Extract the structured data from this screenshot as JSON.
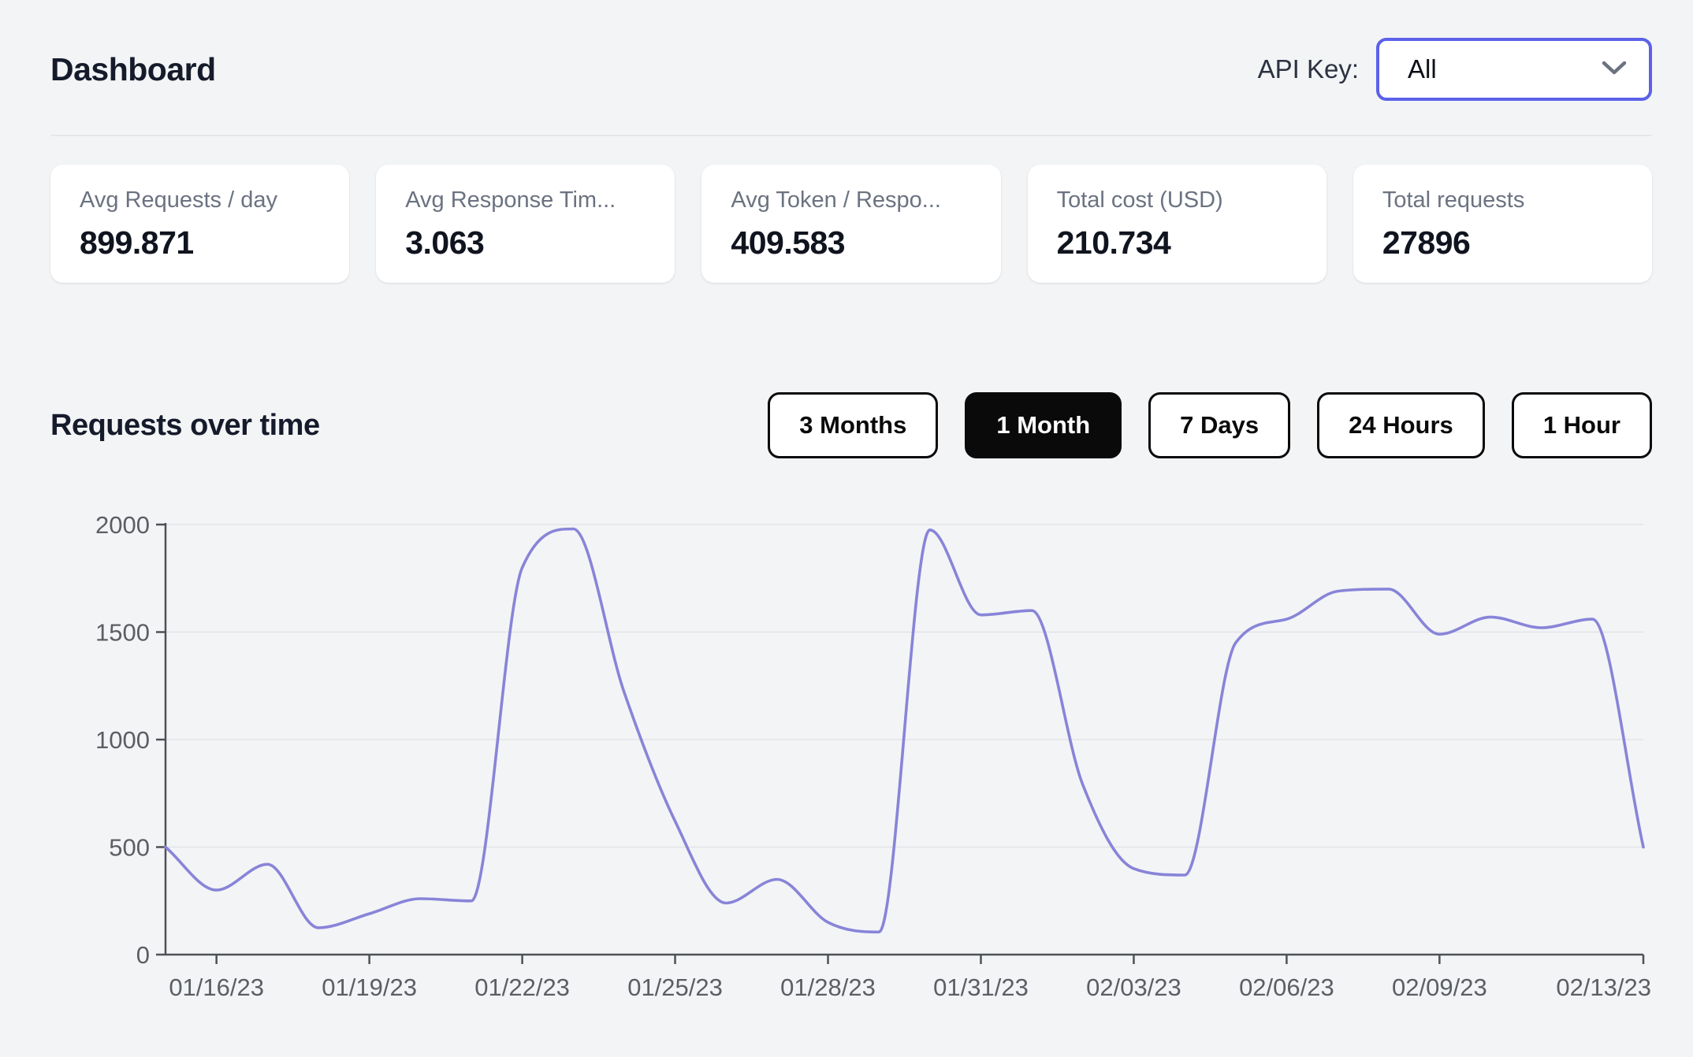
{
  "header": {
    "title": "Dashboard",
    "api_key_label": "API Key:",
    "api_key_value": "All"
  },
  "stats": [
    {
      "label": "Avg Requests / day",
      "value": "899.871"
    },
    {
      "label": "Avg Response Tim...",
      "value": "3.063"
    },
    {
      "label": "Avg Token / Respo...",
      "value": "409.583"
    },
    {
      "label": "Total cost (USD)",
      "value": "210.734"
    },
    {
      "label": "Total requests",
      "value": "27896"
    }
  ],
  "section": {
    "title": "Requests over time"
  },
  "time_ranges": {
    "options": [
      "3 Months",
      "1 Month",
      "7 Days",
      "24 Hours",
      "1 Hour"
    ],
    "selected": "1 Month"
  },
  "chart_data": {
    "type": "line",
    "title": "Requests over time",
    "x": [
      "01/15/23",
      "01/16/23",
      "01/17/23",
      "01/18/23",
      "01/19/23",
      "01/20/23",
      "01/21/23",
      "01/22/23",
      "01/23/23",
      "01/24/23",
      "01/25/23",
      "01/26/23",
      "01/27/23",
      "01/28/23",
      "01/29/23",
      "01/30/23",
      "01/31/23",
      "02/01/23",
      "02/02/23",
      "02/03/23",
      "02/04/23",
      "02/05/23",
      "02/06/23",
      "02/07/23",
      "02/08/23",
      "02/09/23",
      "02/10/23",
      "02/11/23",
      "02/12/23",
      "02/13/23"
    ],
    "values": [
      500,
      300,
      420,
      125,
      190,
      260,
      250,
      1800,
      1980,
      1220,
      620,
      240,
      350,
      150,
      105,
      1975,
      1580,
      1600,
      790,
      400,
      370,
      1450,
      1560,
      1690,
      1700,
      1490,
      1570,
      1520,
      1560,
      500
    ],
    "x_ticks": [
      {
        "index": 1,
        "label": "01/16/23"
      },
      {
        "index": 4,
        "label": "01/19/23"
      },
      {
        "index": 7,
        "label": "01/22/23"
      },
      {
        "index": 10,
        "label": "01/25/23"
      },
      {
        "index": 13,
        "label": "01/28/23"
      },
      {
        "index": 16,
        "label": "01/31/23"
      },
      {
        "index": 19,
        "label": "02/03/23"
      },
      {
        "index": 22,
        "label": "02/06/23"
      },
      {
        "index": 25,
        "label": "02/09/23"
      },
      {
        "index": 29,
        "label": "02/13/23"
      }
    ],
    "y_ticks": [
      0,
      500,
      1000,
      1500,
      2000
    ],
    "ylim": [
      0,
      2000
    ],
    "grid": "horizontal",
    "legend": "none",
    "line_color": "#8884d8",
    "axis_color": "#4d5156",
    "grid_color": "#e2e3e7",
    "smooth": "monotone"
  }
}
